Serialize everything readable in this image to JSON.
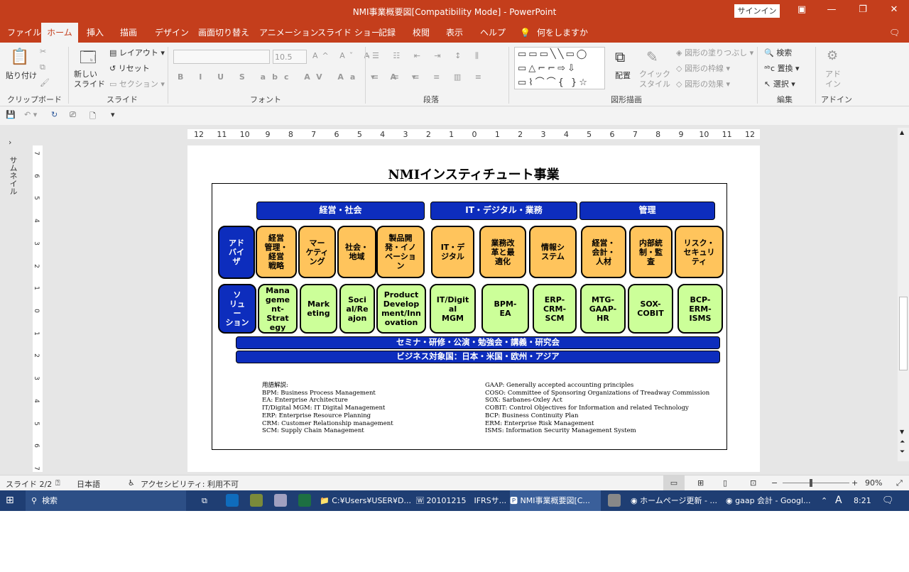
{
  "window": {
    "title": "NMI事業概要図[Compatibility Mode]  -  PowerPoint",
    "signin": "サインイン"
  },
  "menu": {
    "tabs": [
      "ファイル",
      "ホーム",
      "挿入",
      "描画",
      "デザイン",
      "画面切り替え",
      "アニメーション",
      "スライド ショー",
      "記録",
      "校閲",
      "表示",
      "ヘルプ"
    ],
    "tell_me": "何をしますか"
  },
  "ribbon": {
    "paste": "貼り付け",
    "new_slide": "新しい\nスライド",
    "layout": "レイアウト",
    "reset": "リセット",
    "section": "セクション",
    "font_size": "10.5",
    "arrange": "配置",
    "quick_style": "クイック\nスタイル",
    "shape_fill": "図形の塗りつぶし",
    "shape_outline": "図形の枠線",
    "shape_effect": "図形の効果",
    "find": "検索",
    "replace": "置換",
    "select": "選択",
    "addin": "アド\nイン",
    "groups": {
      "clipboard": "クリップボード",
      "slide": "スライド",
      "font": "フォント",
      "paragraph": "段落",
      "drawing": "図形描画",
      "edit": "編集",
      "addin": "アドイン"
    }
  },
  "thumbnails_label": "サムネイル",
  "ruler": {
    "h_ticks": [
      "12",
      "11",
      "10",
      "9",
      "8",
      "7",
      "6",
      "5",
      "4",
      "3",
      "2",
      "1",
      "0",
      "1",
      "2",
      "3",
      "4",
      "5",
      "6",
      "7",
      "8",
      "9",
      "10",
      "11",
      "12"
    ],
    "v_ticks": [
      "7",
      "6",
      "5",
      "4",
      "3",
      "2",
      "1",
      "0",
      "1",
      "2",
      "3",
      "4",
      "5",
      "6",
      "7"
    ]
  },
  "slide": {
    "title": "NMIインスティチュート事業",
    "headers": [
      "経営・社会",
      "IT・デジタル・業務",
      "管理"
    ],
    "advisor": "アド\nバイ\nザ",
    "solution": "ソ\nリュ\nー\nション",
    "orange": [
      "経営\n管理・\n経営\n戦略",
      "マー\nケティ\nング",
      "社会・\n地域",
      "製品開\n発・イノ\nベーショ\nン",
      "IT・デ\nジタル",
      "業務改\n革と最\n適化",
      "情報シ\nステム",
      "経営・\n会計・\n人材",
      "内部統\n制・監\n査",
      "リスク・\nセキュリ\nティ"
    ],
    "green": [
      "Mana\ngeme\nnt-\nStrat\negy",
      "Mark\neting",
      "Soci\nal/Re\najon",
      "Product\nDevelop\nment/Inn\novation",
      "IT/Digit\nal\nMGM",
      "BPM-\nEA",
      "ERP-\nCRM-\nSCM",
      "MTG-\nGAAP-\nHR",
      "SOX-\nCOBIT",
      "BCP-\nERM-\nISMS"
    ],
    "bar1": "セミナ・研修・公演・勉強会・講義・研究会",
    "bar2": "ビジネス対象国：日本・米国・欧州・アジア",
    "glossary_title": "用語解説:",
    "glossary_left": [
      "BPM:  Business  Process  Management",
      "EA:  Enterprise  Architecture",
      "IT/Digital MGM:  IT  Digital Management",
      "ERP:  Enterprise  Resource  Planning",
      "CRM:  Customer  Relationship  management",
      "SCM:  Supply  Chain  Management"
    ],
    "glossary_right": [
      "GAAP: Generally accepted accounting principles",
      "COSO:  Committee of Sponsoring Organizations  of  Treadway Commission",
      "SOX:  Sarbanes-Oxley Act",
      "COBIT:  Control  Objectives  for  Information   and related  Technology",
      "BCP:  Business  Continuity  Plan",
      "ERM:  Enterprise  Risk  Management",
      "ISMS:  Information  Security  Management  System"
    ]
  },
  "status": {
    "slide": "スライド 2/2",
    "language": "日本語",
    "accessibility": "アクセシビリティ: 利用不可",
    "zoom": "90%"
  },
  "taskbar": {
    "search": "検索",
    "items": [
      "C:¥Users¥USER¥D...",
      "20101215　IFRSサ...",
      "NMI事業概要図[C...",
      "ホームページ更新 - ...",
      "gaap 会計 - Googl..."
    ],
    "ime": "A",
    "time": "8:21"
  },
  "colors": {
    "accent": "#c43e1c",
    "header_blue": "#0d2dbd",
    "orange_box": "#ffc45c",
    "green_box": "#ccff99",
    "taskbar": "#1f3e73"
  }
}
